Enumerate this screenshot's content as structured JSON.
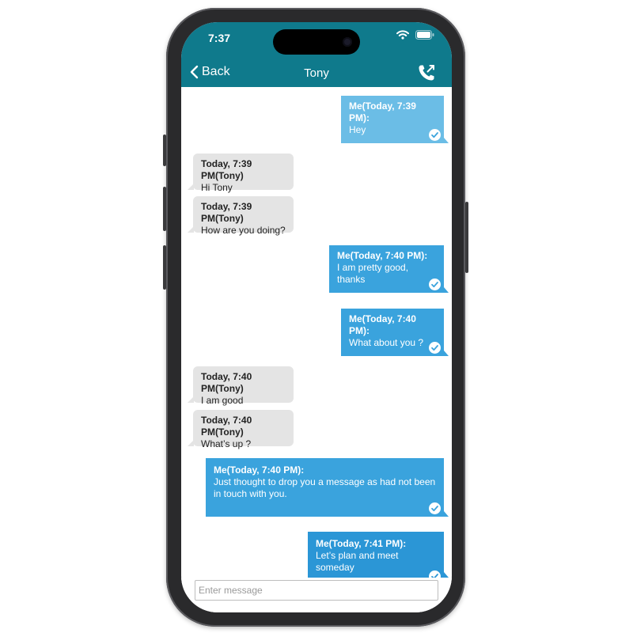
{
  "status": {
    "time": "7:37"
  },
  "nav": {
    "back_label": "Back",
    "title": "Tony"
  },
  "colors": {
    "header": "#0f7a8c",
    "incoming": "#e4e4e4",
    "outgoing_light": "#6bbde6",
    "outgoing": "#3aa3dd",
    "outgoing_dark": "#2b96d6"
  },
  "icons": {
    "back": "chevron-left-icon",
    "call": "phone-call-icon",
    "read": "check-circle-icon"
  },
  "messages": [
    {
      "from": "me",
      "header": "Me(Today, 7:39 PM):",
      "text": "Hey"
    },
    {
      "from": "tony",
      "header": "Today, 7:39 PM(Tony)",
      "text": "Hi Tony"
    },
    {
      "from": "tony",
      "header": "Today, 7:39 PM(Tony)",
      "text": "How are you doing?"
    },
    {
      "from": "me",
      "header": "Me(Today, 7:40 PM):",
      "text": "I am pretty good, thanks"
    },
    {
      "from": "me",
      "header": "Me(Today, 7:40 PM):",
      "text": "What about you ?"
    },
    {
      "from": "tony",
      "header": "Today, 7:40 PM(Tony)",
      "text": "I am good"
    },
    {
      "from": "tony",
      "header": "Today, 7:40 PM(Tony)",
      "text": "What’s up ?"
    },
    {
      "from": "me",
      "header": "Me(Today, 7:40 PM):",
      "text": "Just thought to drop you a message as had not been in touch with you."
    },
    {
      "from": "me",
      "header": "Me(Today, 7:41 PM):",
      "text": "Let’s plan and meet someday"
    }
  ],
  "composer": {
    "placeholder": "Enter message"
  }
}
